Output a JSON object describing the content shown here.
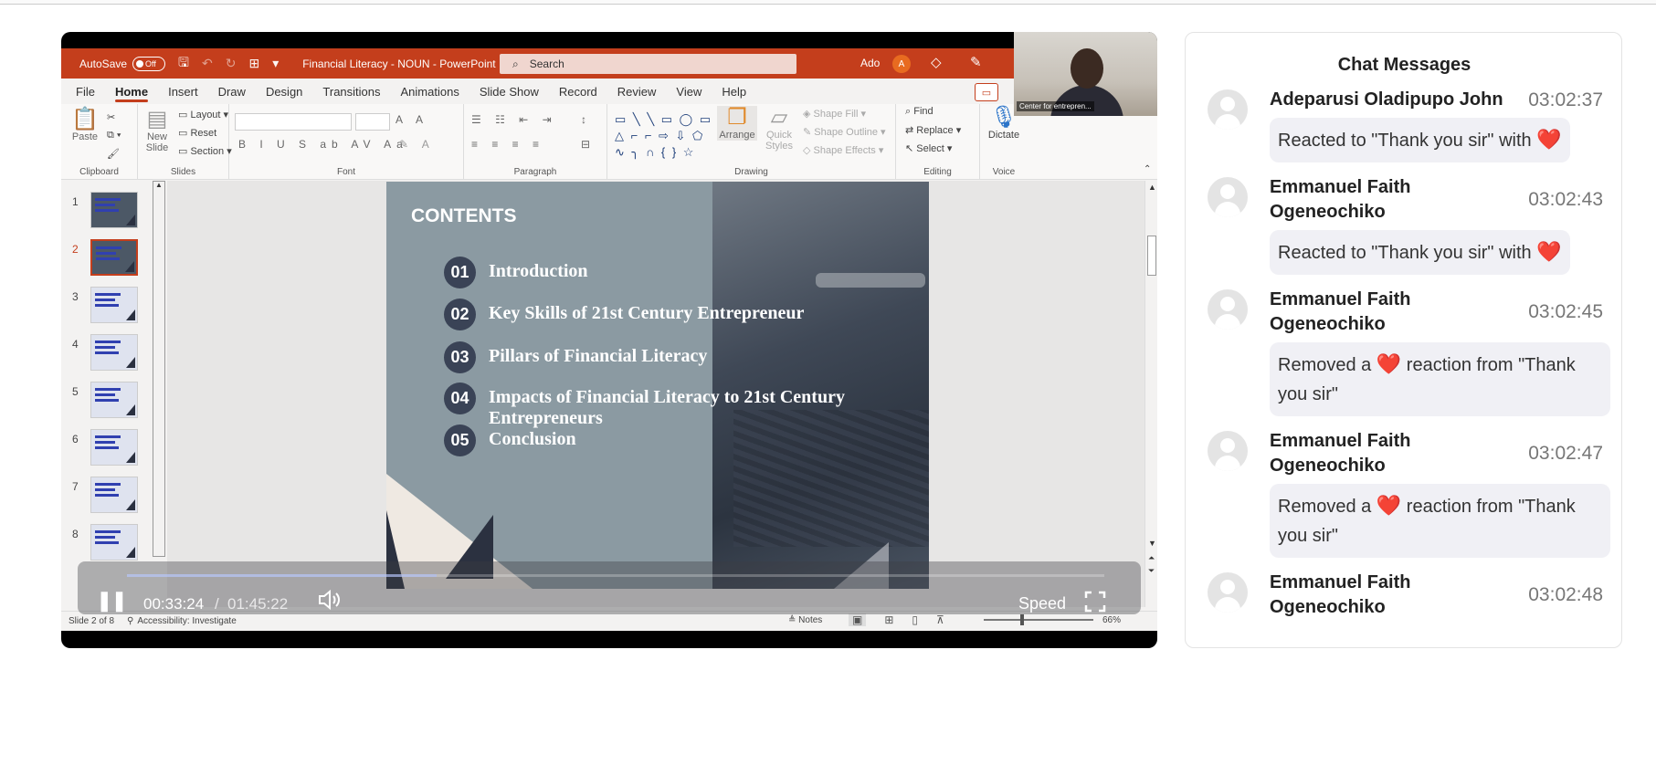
{
  "ppt": {
    "autosave_label": "AutoSave",
    "autosave_state": "Off",
    "doc_title": "Financial Literacy - NOUN  -  PowerPoint",
    "search_placeholder": "Search",
    "user_name": "Ado",
    "user_initial": "A",
    "tabs": [
      "File",
      "Home",
      "Insert",
      "Draw",
      "Design",
      "Transitions",
      "Animations",
      "Slide Show",
      "Record",
      "Review",
      "View",
      "Help"
    ],
    "active_tab": "Home",
    "ribbon": {
      "paste": "Paste",
      "clipboard_group": "Clipboard",
      "new_slide": "New Slide",
      "layout": "Layout",
      "reset": "Reset",
      "section": "Section",
      "slides_group": "Slides",
      "font_group": "Font",
      "paragraph_group": "Paragraph",
      "arrange": "Arrange",
      "quick_styles": "Quick Styles",
      "shape_fill": "Shape Fill",
      "shape_outline": "Shape Outline",
      "shape_effects": "Shape Effects",
      "drawing_group": "Drawing",
      "find": "Find",
      "replace": "Replace",
      "select": "Select",
      "editing_group": "Editing",
      "dictate": "Dictate",
      "voice_group": "Voice"
    },
    "thumbnails": [
      "1",
      "2",
      "3",
      "4",
      "5",
      "6",
      "7",
      "8"
    ],
    "selected_slide": "2",
    "slide": {
      "title": "CONTENTS",
      "items": [
        {
          "num": "01",
          "text": "Introduction"
        },
        {
          "num": "02",
          "text": "Key Skills  of 21st Century Entrepreneur"
        },
        {
          "num": "03",
          "text": "Pillars of Financial Literacy"
        },
        {
          "num": "04",
          "text": "Impacts of Financial Literacy to 21st  Century Entrepreneurs"
        },
        {
          "num": "05",
          "text": "Conclusion"
        }
      ]
    },
    "status": {
      "slide_info": "Slide 2 of 8",
      "accessibility": "Accessibility: Investigate",
      "notes": "Notes",
      "zoom": "66%"
    }
  },
  "webcam": {
    "label": "Center for entrepren..."
  },
  "video": {
    "current_time": "00:33:24",
    "separator": "/",
    "total_time": "01:45:22",
    "progress": 0.317,
    "speed_label": "Speed"
  },
  "chat": {
    "title": "Chat Messages",
    "messages": [
      {
        "name": "Adeparusi Oladipupo John",
        "time": "03:02:37",
        "pre": "Reacted to \"Thank you sir\" with ",
        "post": ""
      },
      {
        "name": "Emmanuel Faith Ogeneochiko",
        "time": "03:02:43",
        "pre": "Reacted to \"Thank you sir\" with ",
        "post": ""
      },
      {
        "name": "Emmanuel Faith Ogeneochiko",
        "time": "03:02:45",
        "pre": "Removed a ",
        "post": " reaction from \"Thank you sir\""
      },
      {
        "name": "Emmanuel Faith Ogeneochiko",
        "time": "03:02:47",
        "pre": "Removed a ",
        "post": " reaction from \"Thank you sir\""
      },
      {
        "name": "Emmanuel Faith Ogeneochiko",
        "time": "03:02:48",
        "pre": "",
        "post": ""
      }
    ]
  },
  "colors": {
    "ppt_accent": "#c43e1c",
    "heart": "#e0141e"
  }
}
